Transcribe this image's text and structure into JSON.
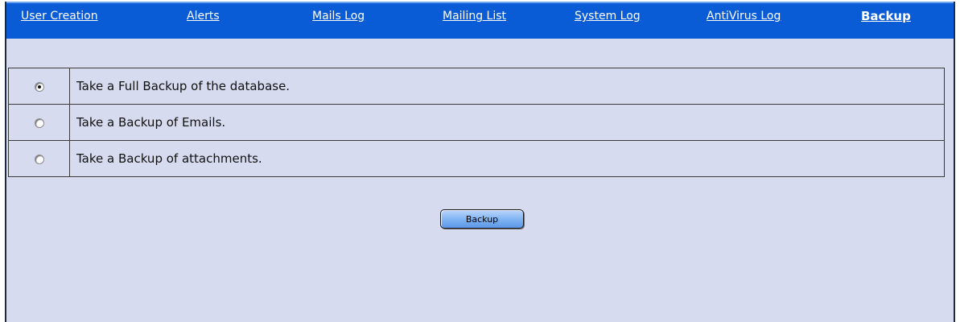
{
  "nav": {
    "items": [
      {
        "label": "User Creation",
        "active": false
      },
      {
        "label": "Alerts",
        "active": false
      },
      {
        "label": "Mails Log",
        "active": false
      },
      {
        "label": "Mailing List",
        "active": false
      },
      {
        "label": "System Log",
        "active": false
      },
      {
        "label": "AntiVirus Log",
        "active": false
      },
      {
        "label": "Backup",
        "active": true
      }
    ]
  },
  "backup_options": [
    {
      "label": "Take a Full Backup of the database.",
      "selected": true
    },
    {
      "label": "Take a Backup of Emails.",
      "selected": false
    },
    {
      "label": "Take a Backup of attachments.",
      "selected": false
    }
  ],
  "actions": {
    "backup_label": "Backup"
  },
  "colors": {
    "nav_background": "#0a5bd6",
    "page_background": "#d6dbef",
    "button_gradient": "#7eb2f3"
  }
}
